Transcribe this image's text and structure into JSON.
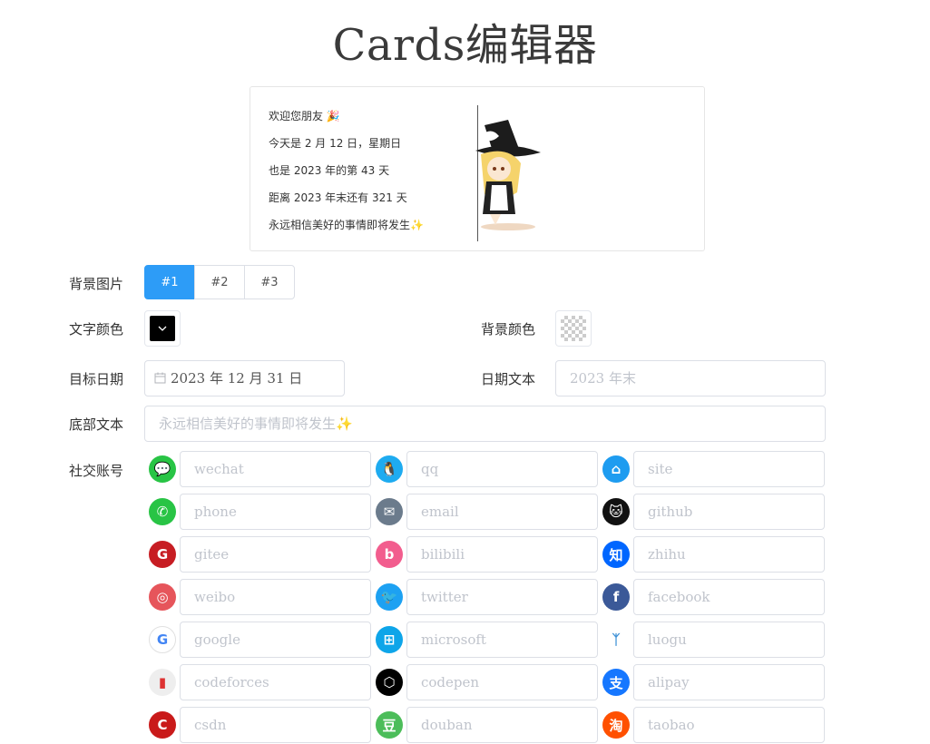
{
  "title": "Cards编辑器",
  "card": {
    "lines": [
      "欢迎您朋友 🎉",
      "今天是 2 月 12 日，星期日",
      "也是 2023 年的第 43 天",
      "距离 2023 年末还有 321 天",
      "永远相信美好的事情即将发生✨"
    ]
  },
  "form": {
    "background_image_label": "背景图片",
    "background_image_options": [
      "#1",
      "#2",
      "#3"
    ],
    "background_image_selected": "#1",
    "text_color_label": "文字颜色",
    "text_color_value": "#000000",
    "bg_color_label": "背景颜色",
    "target_date_label": "目标日期",
    "target_date_value": "2023 年 12 月 31 日",
    "date_text_label": "日期文本",
    "date_text_placeholder": "2023 年末",
    "footer_text_label": "底部文本",
    "footer_text_placeholder": "永远相信美好的事情即将发生✨",
    "social_label": "社交账号"
  },
  "socials": [
    {
      "name": "wechat",
      "icon": "wechat-icon",
      "color": "#28c445",
      "glyph": "💬"
    },
    {
      "name": "qq",
      "icon": "qq-icon",
      "color": "#1eabf0",
      "glyph": "🐧"
    },
    {
      "name": "site",
      "icon": "home-icon",
      "color": "#1e9cf0",
      "glyph": "⌂"
    },
    {
      "name": "phone",
      "icon": "phone-icon",
      "color": "#28c445",
      "glyph": "✆"
    },
    {
      "name": "email",
      "icon": "email-icon",
      "color": "#6b7b8c",
      "glyph": "✉"
    },
    {
      "name": "github",
      "icon": "github-icon",
      "color": "#111111",
      "glyph": "🐱"
    },
    {
      "name": "gitee",
      "icon": "gitee-icon",
      "color": "#c71d23",
      "glyph": "G"
    },
    {
      "name": "bilibili",
      "icon": "bilibili-icon",
      "color": "#f25d8e",
      "glyph": "b"
    },
    {
      "name": "zhihu",
      "icon": "zhihu-icon",
      "color": "#0066ff",
      "glyph": "知"
    },
    {
      "name": "weibo",
      "icon": "weibo-icon",
      "color": "#e6555b",
      "glyph": "◎"
    },
    {
      "name": "twitter",
      "icon": "twitter-icon",
      "color": "#1da1f2",
      "glyph": "🐦"
    },
    {
      "name": "facebook",
      "icon": "facebook-icon",
      "color": "#3b5998",
      "glyph": "f"
    },
    {
      "name": "google",
      "icon": "google-icon",
      "color": "#ffffff",
      "glyph": "G"
    },
    {
      "name": "microsoft",
      "icon": "microsoft-icon",
      "color": "#0ea5e9",
      "glyph": "⊞"
    },
    {
      "name": "luogu",
      "icon": "luogu-icon",
      "color": "#ffffff",
      "glyph": "ᛉ"
    },
    {
      "name": "codeforces",
      "icon": "codeforces-icon",
      "color": "#eeeeee",
      "glyph": "▮"
    },
    {
      "name": "codepen",
      "icon": "codepen-icon",
      "color": "#000000",
      "glyph": "⬡"
    },
    {
      "name": "alipay",
      "icon": "alipay-icon",
      "color": "#1677ff",
      "glyph": "支"
    },
    {
      "name": "csdn",
      "icon": "csdn-icon",
      "color": "#c91a1a",
      "glyph": "C"
    },
    {
      "name": "douban",
      "icon": "douban-icon",
      "color": "#4cbd5a",
      "glyph": "豆"
    },
    {
      "name": "taobao",
      "icon": "taobao-icon",
      "color": "#ff5000",
      "glyph": "淘"
    }
  ]
}
